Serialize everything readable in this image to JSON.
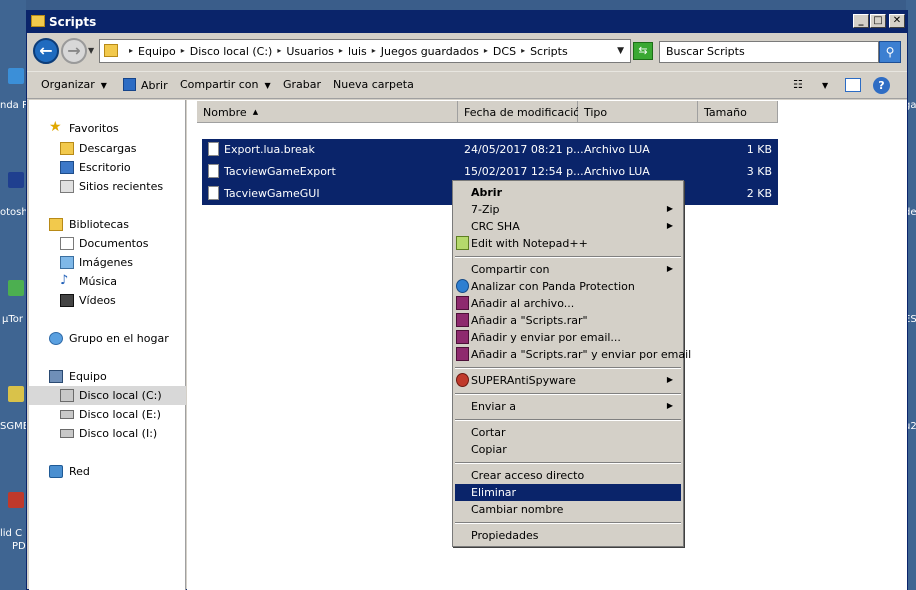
{
  "window": {
    "title": "Scripts"
  },
  "address": {
    "crumbs": [
      "Equipo",
      "Disco local (C:)",
      "Usuarios",
      "luis",
      "Juegos guardados",
      "DCS",
      "Scripts"
    ]
  },
  "search": {
    "placeholder": "Buscar Scripts"
  },
  "toolbar": {
    "organize": "Organizar",
    "open": "Abrir",
    "share": "Compartir con",
    "burn": "Grabar",
    "new_folder": "Nueva carpeta"
  },
  "nav": {
    "favorites": "Favoritos",
    "downloads": "Descargas",
    "desktop": "Escritorio",
    "recent": "Sitios recientes",
    "libraries": "Bibliotecas",
    "documents": "Documentos",
    "images": "Imágenes",
    "music": "Música",
    "videos": "Vídeos",
    "homegroup": "Grupo en el hogar",
    "computer": "Equipo",
    "disk_c": "Disco local (C:)",
    "disk_e": "Disco local (E:)",
    "disk_i": "Disco local (I:)",
    "network": "Red"
  },
  "columns": {
    "name": "Nombre",
    "modified": "Fecha de modificación",
    "type": "Tipo",
    "size": "Tamaño"
  },
  "files": [
    {
      "name": "Export.lua.break",
      "modified": "24/05/2017 08:21 p...",
      "type": "Archivo LUA",
      "size": "1 KB"
    },
    {
      "name": "TacviewGameExport",
      "modified": "15/02/2017 12:54 p...",
      "type": "Archivo LUA",
      "size": "3 KB"
    },
    {
      "name": "TacviewGameGUI",
      "modified": "",
      "type": "",
      "size": "2 KB"
    }
  ],
  "menu": {
    "open": "Abrir",
    "zip7": "7-Zip",
    "crc": "CRC SHA",
    "notepad": "Edit with Notepad++",
    "share": "Compartir con",
    "panda": "Analizar con Panda Protection",
    "add_archive": "Añadir al archivo...",
    "add_rar": "Añadir a \"Scripts.rar\"",
    "add_email": "Añadir y enviar por email...",
    "add_rar_email": "Añadir a \"Scripts.rar\" y enviar por email",
    "superanti": "SUPERAntiSpyware",
    "send_to": "Enviar a",
    "cut": "Cortar",
    "copy": "Copiar",
    "shortcut": "Crear acceso directo",
    "delete": "Eliminar",
    "rename": "Cambiar nombre",
    "properties": "Propiedades"
  },
  "desktop_labels": {
    "l1": "nda P",
    "l2": "otosh",
    "l3": "µTor",
    "l4": "SGME",
    "l5": "lid C",
    "l6": "PD",
    "r1": "ga",
    "r2": "de",
    "r3": "ES",
    "r4": "u2"
  }
}
